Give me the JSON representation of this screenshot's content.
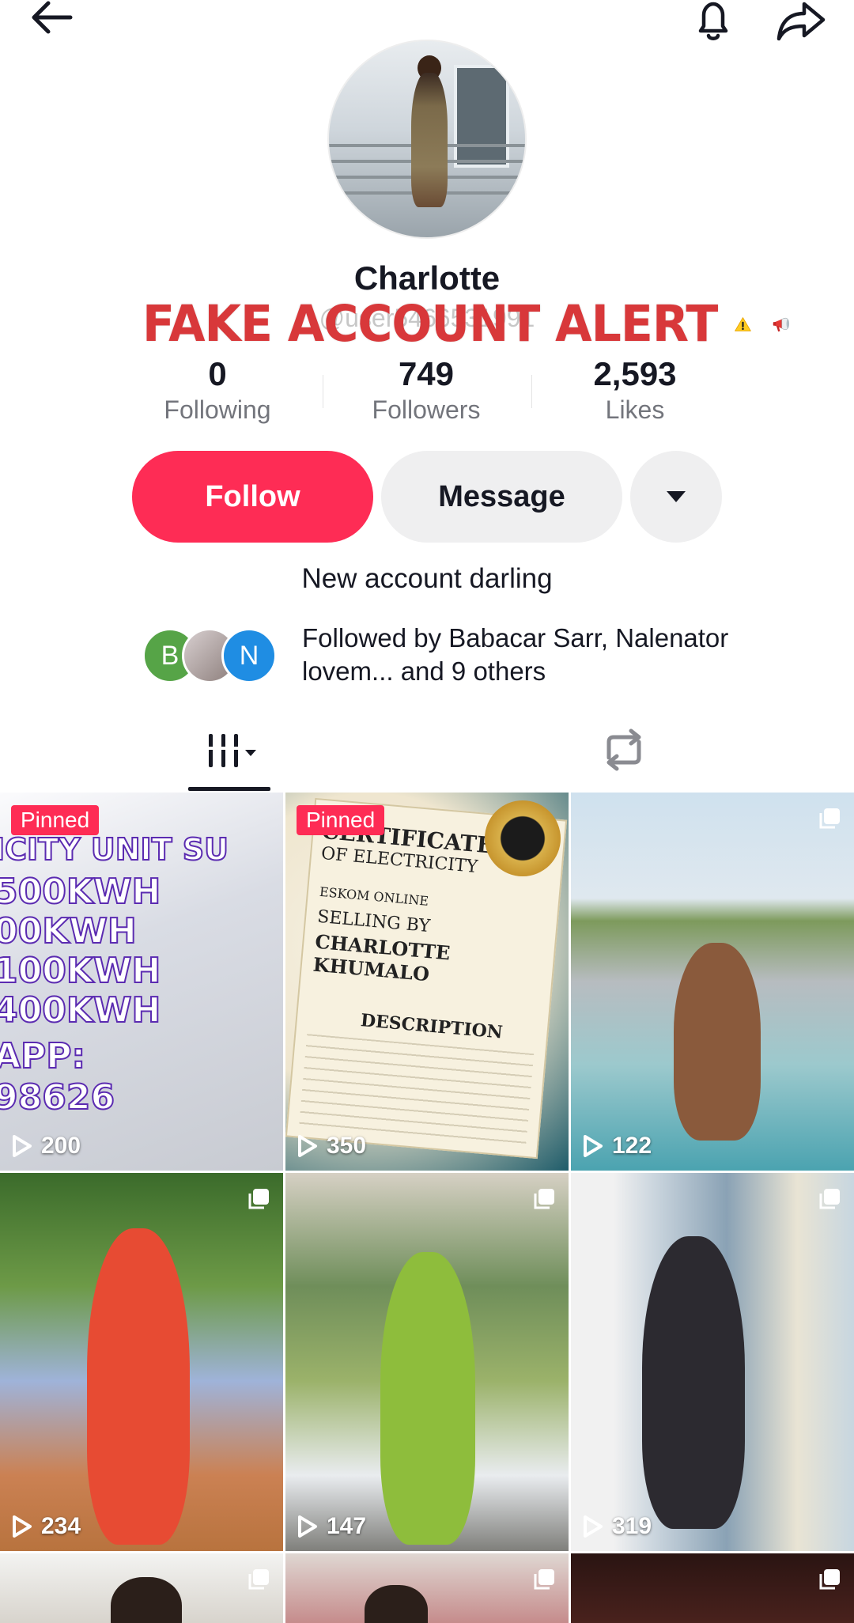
{
  "profile": {
    "name": "Charlotte",
    "handle": "@user5466531991",
    "alert_text": "FAKE ACCOUNT ALERT",
    "bio": "New account darling"
  },
  "stats": [
    {
      "value": "0",
      "label": "Following"
    },
    {
      "value": "749",
      "label": "Followers"
    },
    {
      "value": "2,593",
      "label": "Likes"
    }
  ],
  "actions": {
    "follow": "Follow",
    "message": "Message"
  },
  "followed_by": {
    "avatars": [
      "B",
      "",
      "N"
    ],
    "text": "Followed by Babacar Sarr, Nalenator lovem... and 9 others"
  },
  "colors": {
    "accent": "#fe2c55",
    "alert": "#d8383a"
  },
  "grid": [
    {
      "views": "200",
      "pinned": "Pinned",
      "lines": [
        "ICITY UNIT SU",
        "500KWH",
        "00KWH",
        "100KWH",
        "400KWH",
        "APP:",
        "98626"
      ]
    },
    {
      "views": "350",
      "pinned": "Pinned",
      "lines": [
        "CERTIFICATE",
        "OF ELECTRICITY",
        "ESKOM ONLINE",
        "SELLING BY",
        "CHARLOTTE KHUMALO",
        "DESCRIPTION"
      ]
    },
    {
      "views": "122"
    },
    {
      "views": "234"
    },
    {
      "views": "147"
    },
    {
      "views": "319"
    },
    {
      "views": ""
    },
    {
      "views": ""
    },
    {
      "views": ""
    }
  ]
}
